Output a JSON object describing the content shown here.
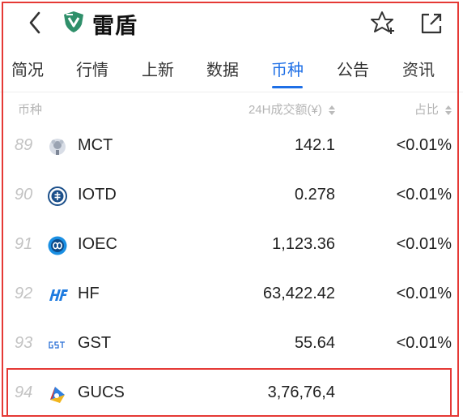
{
  "header": {
    "title": "雷盾",
    "brand_color": "#2f8f6a"
  },
  "tabs": [
    {
      "label": "简况"
    },
    {
      "label": "行情"
    },
    {
      "label": "上新"
    },
    {
      "label": "数据"
    },
    {
      "label": "币种",
      "active": true
    },
    {
      "label": "公告"
    },
    {
      "label": "资讯"
    }
  ],
  "table": {
    "headers": {
      "coin": "币种",
      "volume": "24H成交额(¥)",
      "share": "占比"
    },
    "rows": [
      {
        "rank": "89",
        "symbol": "MCT",
        "volume": "142.1",
        "share": "<0.01%",
        "icon": "mct-icon"
      },
      {
        "rank": "90",
        "symbol": "IOTD",
        "volume": "0.278",
        "share": "<0.01%",
        "icon": "iotd-icon"
      },
      {
        "rank": "91",
        "symbol": "IOEC",
        "volume": "1,123.36",
        "share": "<0.01%",
        "icon": "ioec-icon"
      },
      {
        "rank": "92",
        "symbol": "HF",
        "volume": "63,422.42",
        "share": "<0.01%",
        "icon": "hf-icon"
      },
      {
        "rank": "93",
        "symbol": "GST",
        "volume": "55.64",
        "share": "<0.01%",
        "icon": "gst-icon"
      },
      {
        "rank": "94",
        "symbol": "GUCS",
        "volume": "3,76,76,4",
        "share": "",
        "icon": "gucs-icon"
      }
    ]
  },
  "colors": {
    "accent": "#1e6fe6",
    "highlight_border": "#e53935",
    "muted": "#b5b5b5"
  }
}
